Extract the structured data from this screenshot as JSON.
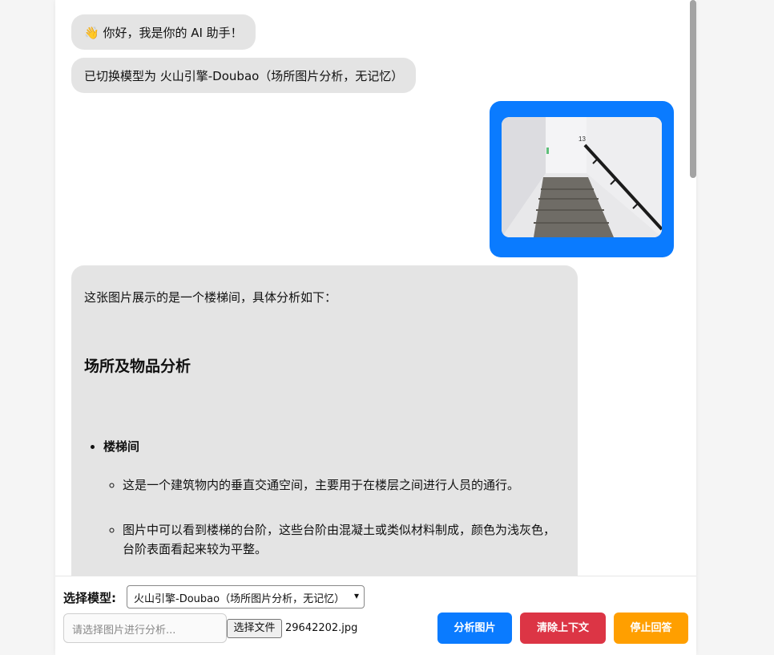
{
  "messages": {
    "greeting": "👋 你好，我是你的 AI 助手！",
    "model_switched": "已切换模型为 火山引擎-Doubao（场所图片分析，无记忆）",
    "user_image_icon": "staircase-photo",
    "analysis": {
      "intro": "这张图片展示的是一个楼梯间，具体分析如下：",
      "heading": "场所及物品分析",
      "item_title": "楼梯间",
      "subitems": [
        "这是一个建筑物内的垂直交通空间，主要用于在楼层之间进行人员的通行。",
        "图片中可以看到楼梯的台阶，这些台阶由混凝土或类似材料制成，颜色为浅灰色，台阶表面看起来较为平整。"
      ]
    }
  },
  "controls": {
    "model_label": "选择模型:",
    "model_selected": "火山引擎-Doubao（场所图片分析，无记忆）",
    "image_placeholder": "请选择图片进行分析...",
    "file_button": "选择文件",
    "file_name": "29642202.jpg",
    "analyze_button": "分析图片",
    "clear_button": "清除上下文",
    "stop_button": "停止回答"
  },
  "colors": {
    "primary": "#0a7bff",
    "danger": "#dc3545",
    "warning": "#ff9f00",
    "ai_bubble": "#e4e4e4"
  }
}
